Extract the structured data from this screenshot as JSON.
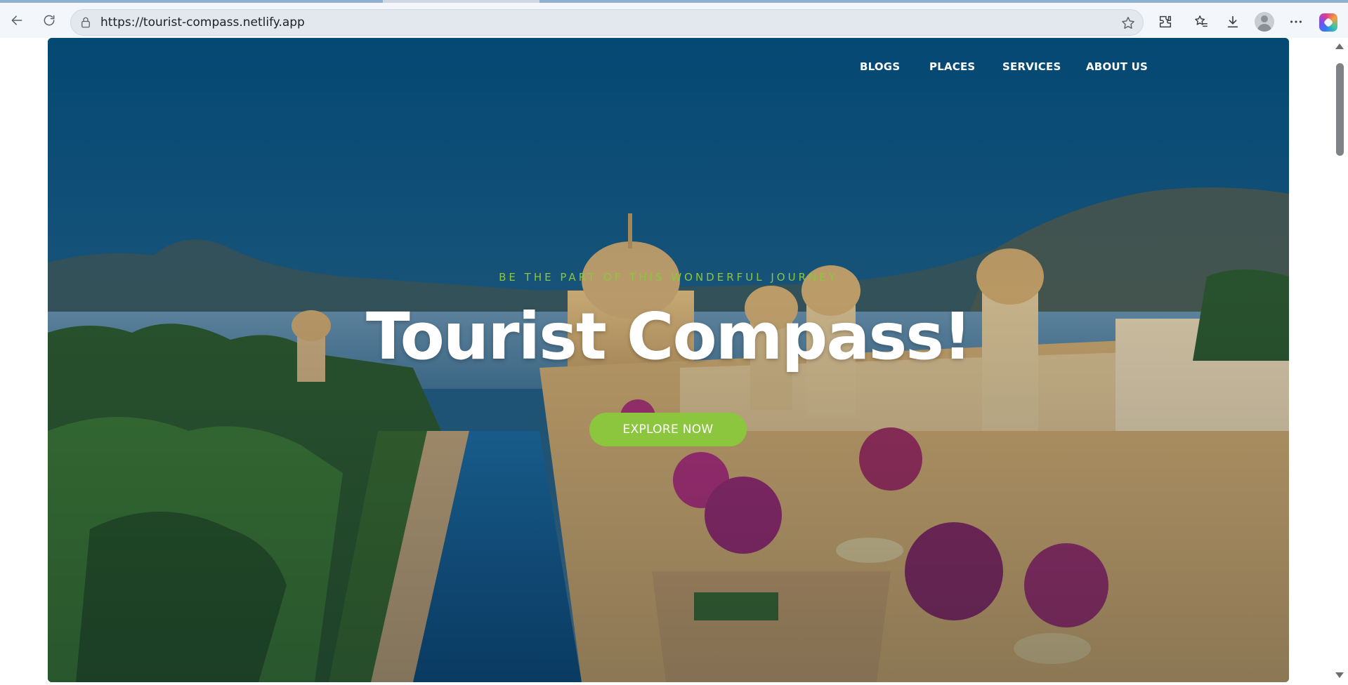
{
  "browser": {
    "url": "https://tourist-compass.netlify.app"
  },
  "nav": {
    "items": [
      {
        "label": "BLOGS"
      },
      {
        "label": "PLACES"
      },
      {
        "label": "SERVICES"
      },
      {
        "label": "ABOUT US"
      }
    ]
  },
  "hero": {
    "tagline": "BE THE PART OF THIS WONDERFUL JOURNEY",
    "title": "Tourist Compass!",
    "cta_label": "EXPLORE NOW"
  },
  "colors": {
    "accent": "#8cc63f",
    "hero_sky": "#0e4a72",
    "chrome": "#f3f6fa"
  }
}
